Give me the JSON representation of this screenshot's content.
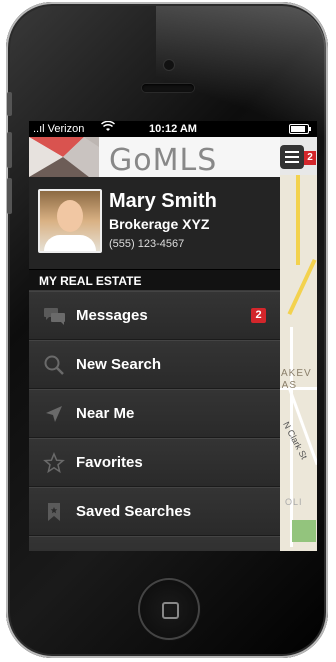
{
  "status": {
    "carrier": "Verizon",
    "time": "10:12 AM",
    "signal_icon": "signal-icon",
    "wifi_icon": "wifi-icon",
    "battery_icon": "battery-icon"
  },
  "app": {
    "logo": "GoMLS",
    "accent": "#d3262b",
    "menu_badge": "2"
  },
  "profile": {
    "name": "Mary Smith",
    "brokerage": "Brokerage XYZ",
    "phone": "(555) 123-4567"
  },
  "section": {
    "title": "MY REAL ESTATE"
  },
  "menu": {
    "items": [
      {
        "label": "Messages",
        "icon": "messages-icon",
        "badge": "2"
      },
      {
        "label": "New Search",
        "icon": "search-icon"
      },
      {
        "label": "Near Me",
        "icon": "location-arrow-icon"
      },
      {
        "label": "Favorites",
        "icon": "star-icon"
      },
      {
        "label": "Saved Searches",
        "icon": "bookmark-icon"
      }
    ]
  },
  "map": {
    "label_line1": "AKEV",
    "label_line2": "EAS",
    "street": "N Clark St",
    "label_bottom": "OLI"
  }
}
